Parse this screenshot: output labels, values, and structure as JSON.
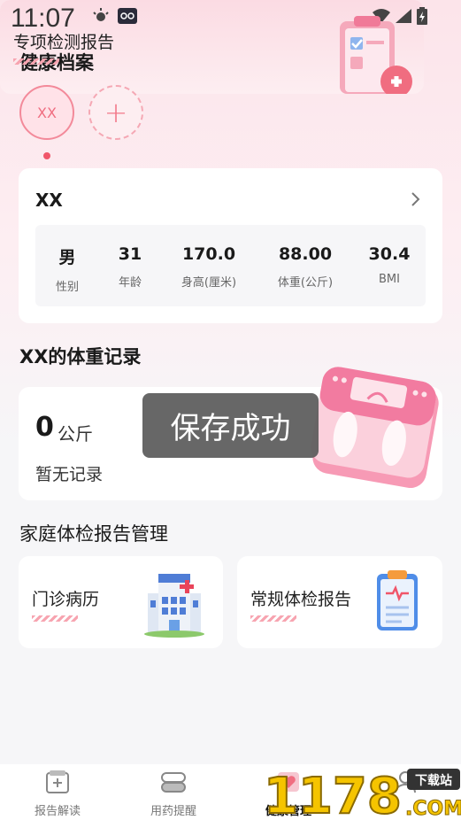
{
  "status": {
    "time": "11:07"
  },
  "page": {
    "title": "健康档案"
  },
  "members": [
    {
      "label": "XX"
    }
  ],
  "profile": {
    "name": "XX",
    "stats": [
      {
        "value": "男",
        "label": "性别"
      },
      {
        "value": "31",
        "label": "年龄"
      },
      {
        "value": "170.0",
        "label": "身高(厘米)"
      },
      {
        "value": "88.00",
        "label": "体重(公斤)"
      },
      {
        "value": "30.4",
        "label": "BMI"
      }
    ]
  },
  "weight": {
    "title": "XX的体重记录",
    "value": "0",
    "unit": "公斤",
    "empty_text": "暂无记录"
  },
  "toast": "保存成功",
  "reports": {
    "title": "家庭体检报告管理",
    "items": [
      {
        "label": "门诊病历",
        "icon": "hospital-icon"
      },
      {
        "label": "常规体检报告",
        "icon": "clipboard-report-icon"
      }
    ],
    "special": {
      "label": "专项检测报告",
      "icon": "checklist-icon"
    }
  },
  "tabs": [
    {
      "label": "报告解读",
      "icon": "report-icon"
    },
    {
      "label": "用药提醒",
      "icon": "pill-icon"
    },
    {
      "label": "健康管理",
      "icon": "heart-icon",
      "active": true
    },
    {
      "label": "",
      "icon": "profile-icon"
    }
  ],
  "watermark": {
    "text1": "1178",
    "text2": "下载站",
    "text3": ".COM"
  },
  "colors": {
    "accent": "#f06d80",
    "background": "#fce4ea"
  }
}
